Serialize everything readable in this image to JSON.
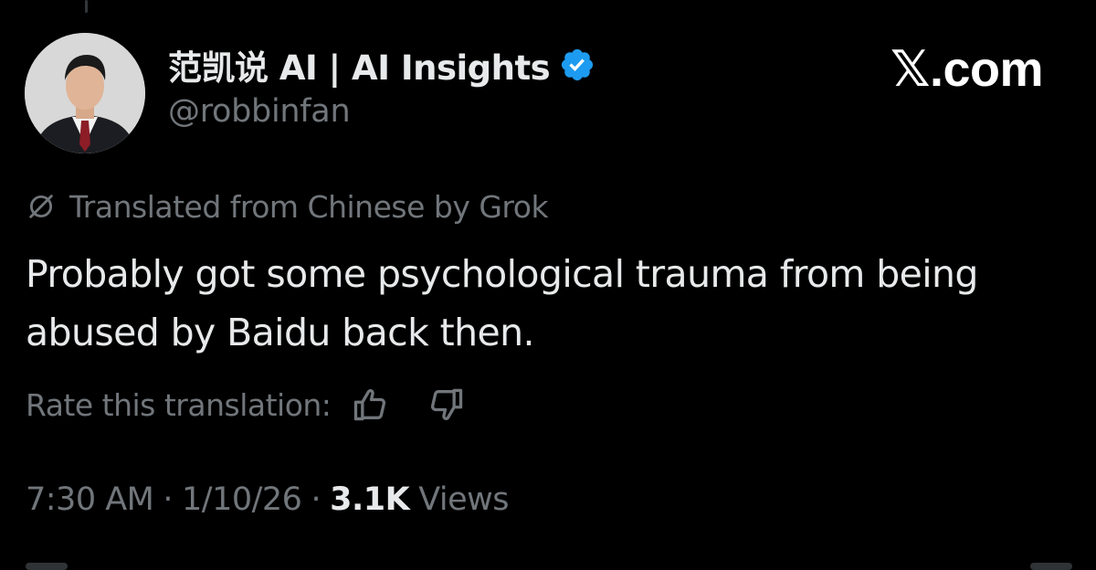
{
  "author": {
    "display_name": "范凯说 AI | AI Insights",
    "handle": "@robbinfan",
    "verified_icon": "verified-badge-icon",
    "avatar_icon": "profile-photo"
  },
  "brand": {
    "label": "𝕏.com"
  },
  "translation": {
    "icon": "grok-icon",
    "notice": "Translated from Chinese by Grok",
    "rate_label": "Rate this translation:",
    "thumbs_up_icon": "thumbs-up-icon",
    "thumbs_down_icon": "thumbs-down-icon"
  },
  "tweet": {
    "text": "Probably got some psychological trauma from being abused by Baidu back then."
  },
  "meta": {
    "time": "7:30 AM",
    "separator": "·",
    "date": "1/10/26",
    "views_count": "3.1K",
    "views_label": "Views"
  },
  "colors": {
    "background": "#000000",
    "primary_text": "#e7e9ea",
    "secondary_text": "#71767b",
    "verified_blue": "#1d9bf0"
  }
}
